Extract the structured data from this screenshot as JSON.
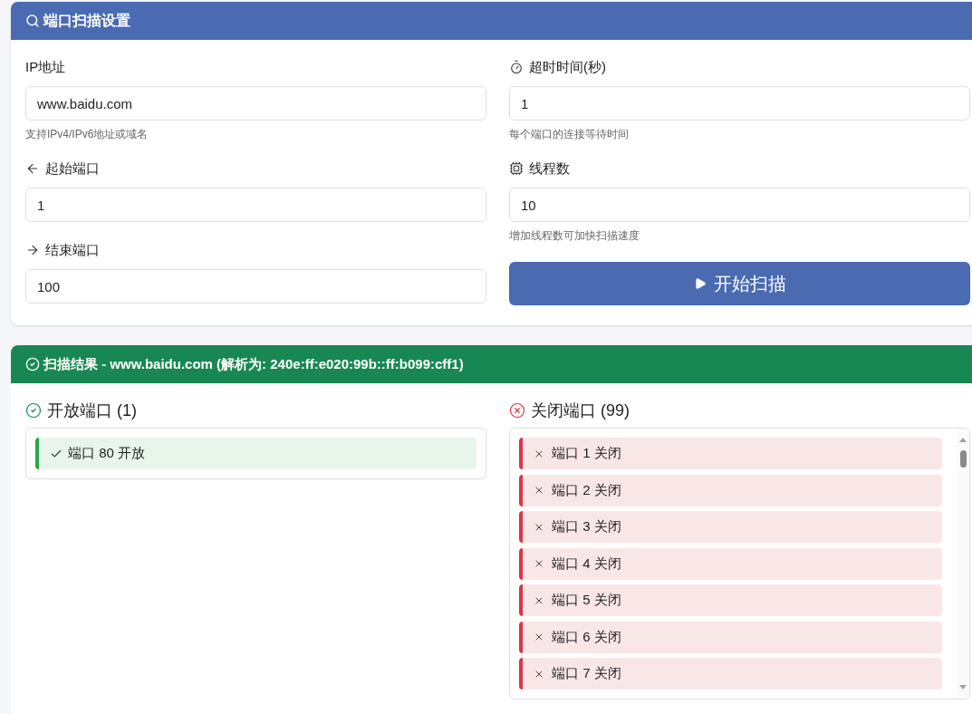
{
  "settings": {
    "title": "端口扫描设置",
    "left_fields": [
      {
        "label": "IP地址",
        "value": "www.baidu.com",
        "hint": "支持IPv4/IPv6地址或域名"
      },
      {
        "label": "起始端口",
        "value": "1"
      },
      {
        "label": "结束端口",
        "value": "100"
      }
    ],
    "right_fields": [
      {
        "label": "超时时间(秒)",
        "value": "1",
        "hint": "每个端口的连接等待时间"
      },
      {
        "label": "线程数",
        "value": "10",
        "hint": "增加线程数可加快扫描速度"
      }
    ],
    "start_button": "开始扫描"
  },
  "results": {
    "title": "扫描结果 - www.baidu.com (解析为: 240e:ff:e020:99b::ff:b099:cff1)",
    "open": {
      "heading": "开放端口 (1)",
      "items": [
        "端口 80 开放"
      ]
    },
    "closed": {
      "heading": "关闭端口 (99)",
      "items": [
        "端口 1 关闭",
        "端口 2 关闭",
        "端口 3 关闭",
        "端口 4 关闭",
        "端口 5 关闭",
        "端口 6 关闭",
        "端口 7 关闭"
      ]
    }
  }
}
